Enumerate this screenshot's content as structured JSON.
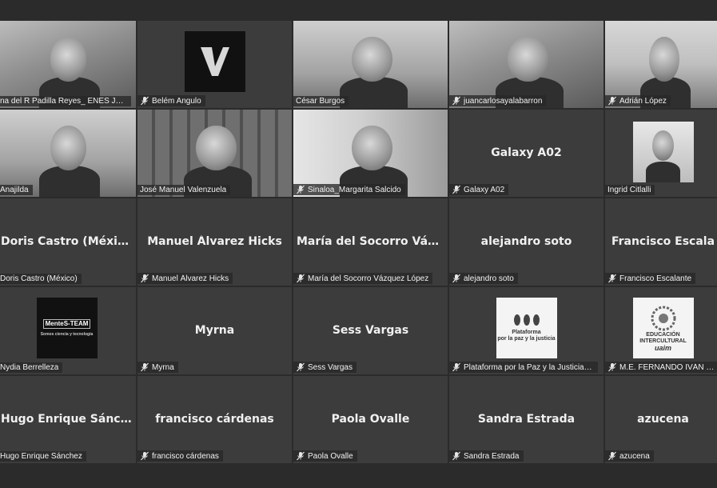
{
  "tiles": [
    {
      "name": "na del R Padilla Reyes_ ENES Juriquil...",
      "type": "video",
      "muted": false
    },
    {
      "name": "Belém Angulo",
      "type": "logo",
      "muted": true
    },
    {
      "name": "César Burgos",
      "type": "video",
      "muted": false
    },
    {
      "name": "juancarlosayalabarron",
      "type": "video",
      "muted": true
    },
    {
      "name": "Adrián López",
      "type": "video",
      "muted": true
    },
    {
      "name": "Anajilda",
      "type": "video",
      "muted": false
    },
    {
      "name": "José Manuel Valenzuela",
      "type": "video",
      "muted": false,
      "active": true
    },
    {
      "name": "Sinaloa_Margarita Salcido",
      "type": "video",
      "muted": true
    },
    {
      "name": "Galaxy A02",
      "display": "Galaxy A02",
      "type": "name",
      "muted": true
    },
    {
      "name": "Ingrid Citlalli",
      "type": "photo",
      "muted": false
    },
    {
      "name": "Doris Castro (México)",
      "display": "Doris Castro (México)",
      "type": "name",
      "muted": false
    },
    {
      "name": "Manuel Álvarez Hicks",
      "display": "Manuel Álvarez Hicks",
      "type": "name",
      "muted": true
    },
    {
      "name": "María del Socorro Vázquez López",
      "display": "María del Socorro Vázque...",
      "type": "name",
      "muted": true
    },
    {
      "name": "alejandro soto",
      "display": "alejandro soto",
      "type": "name",
      "muted": true
    },
    {
      "name": "Francisco Escalante",
      "display": "Francisco Escala",
      "type": "name",
      "muted": true
    },
    {
      "name": "Nydia Berrelleza",
      "type": "logo-mente",
      "muted": false
    },
    {
      "name": "Myrna",
      "display": "Myrna",
      "type": "name",
      "muted": true
    },
    {
      "name": "Sess Vargas",
      "display": "Sess Vargas",
      "type": "name",
      "muted": true
    },
    {
      "name": "Plataforma por la Paz y la Justicia en...",
      "type": "logo-plataforma",
      "muted": true
    },
    {
      "name": "M.E. FERNANDO IVÁN GAR",
      "type": "logo-uaim",
      "muted": true
    },
    {
      "name": "Hugo Enrique Sánchez",
      "display": "Hugo Enrique Sánchez",
      "type": "name",
      "muted": false
    },
    {
      "name": "francisco cárdenas",
      "display": "francisco cárdenas",
      "type": "name",
      "muted": true
    },
    {
      "name": "Paola Ovalle",
      "display": "Paola Ovalle",
      "type": "name",
      "muted": true
    },
    {
      "name": "Sandra Estrada",
      "display": "Sandra Estrada",
      "type": "name",
      "muted": true
    },
    {
      "name": "azucena",
      "display": "azucena",
      "type": "name",
      "muted": true
    }
  ],
  "logos": {
    "mente_title": "MenteS-TEAM",
    "mente_sub": "Somos ciencia y tecnología",
    "plataforma_line1": "Plataforma",
    "plataforma_line2": "por la paz y la justicia",
    "uaim_line1": "EDUCACIÓN",
    "uaim_line2": "INTERCULTURAL",
    "uaim_line3": "uaim"
  },
  "colors": {
    "background": "#2b2b2b",
    "tile": "#3c3c3c",
    "active_border": "#d8d8d8"
  },
  "icons": {
    "mic_muted": "mic-muted-icon"
  }
}
